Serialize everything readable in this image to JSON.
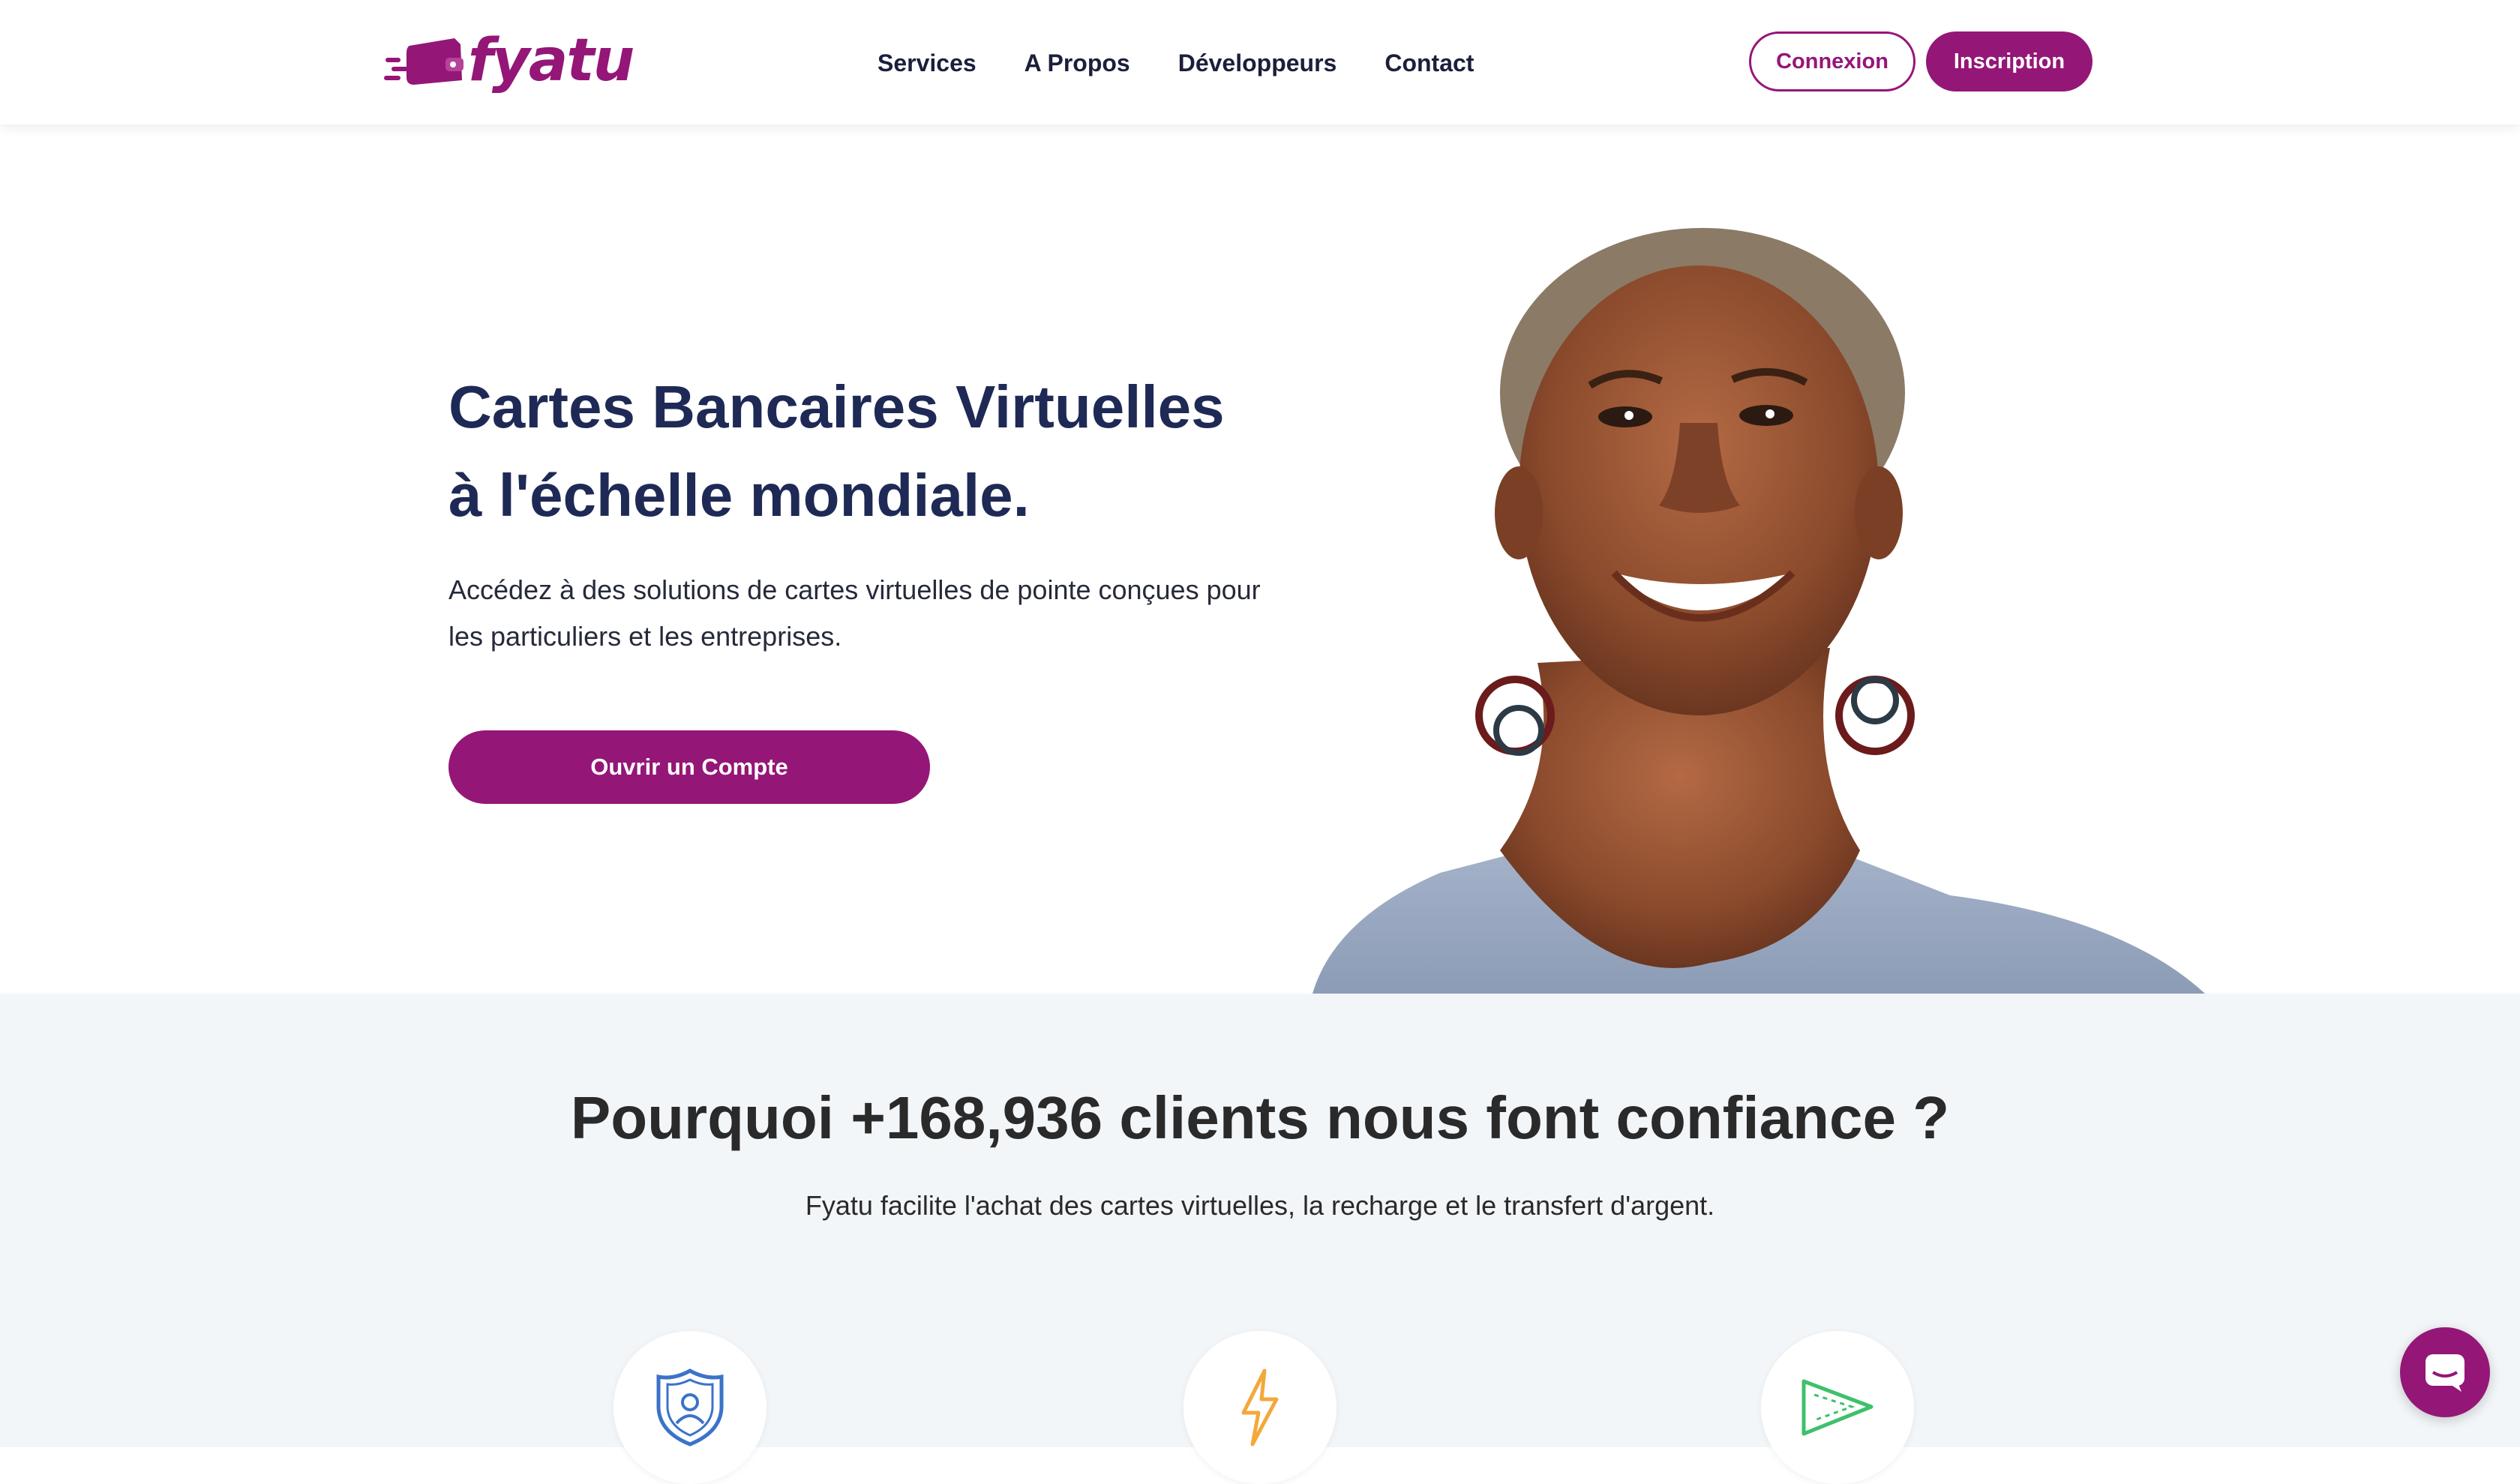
{
  "colors": {
    "brand": "#941677",
    "navy": "#1e2a55",
    "section_bg": "#f3f6f8",
    "icon_blue": "#3b73c9",
    "icon_orange": "#f2a93b",
    "icon_green": "#3fc06b"
  },
  "header": {
    "logo_text": "fyatu",
    "nav": [
      "Services",
      "A Propos",
      "Développeurs",
      "Contact"
    ],
    "login_label": "Connexion",
    "signup_label": "Inscription"
  },
  "hero": {
    "title_line1": "Cartes Bancaires Virtuelles",
    "title_line2": "à l'échelle mondiale.",
    "description": "Accédez à des solutions de cartes virtuelles de pointe conçues pour les particuliers et les entreprises.",
    "cta_label": "Ouvrir un Compte"
  },
  "features": {
    "title": "Pourquoi +168,936 clients nous font confiance ?",
    "subtitle": "Fyatu facilite l'achat des cartes virtuelles, la recharge et le transfert d'argent.",
    "icons": [
      "shield-user-icon",
      "lightning-icon",
      "play-triangle-icon"
    ]
  },
  "chat_widget": {
    "icon": "chat-icon"
  }
}
